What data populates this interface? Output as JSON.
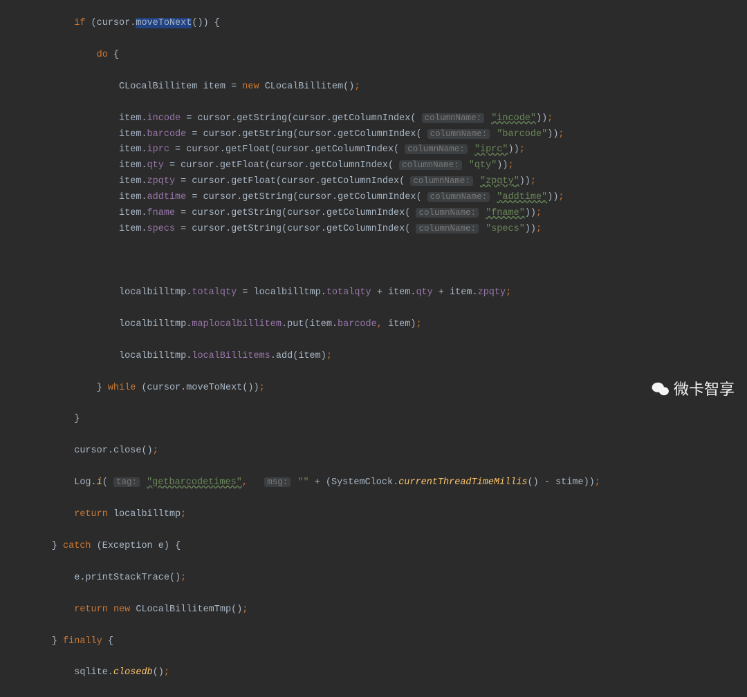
{
  "code": {
    "l1": {
      "kw_if": "if",
      "cur": "cursor",
      "mtn": "moveToNext"
    },
    "l2": {
      "kw_do": "do"
    },
    "l3": {
      "typ": "CLocalBillitem",
      "var": "item",
      "kw_new": "new",
      "ctor": "CLocalBillitem"
    },
    "item_assigns": [
      {
        "field": "incode",
        "getter": "getString",
        "col": "\"incode\"",
        "fieldClass": "fld",
        "strClass": "stru"
      },
      {
        "field": "barcode",
        "getter": "getString",
        "col": "\"barcode\"",
        "fieldClass": "fld",
        "strClass": "str"
      },
      {
        "field": "iprc",
        "getter": "getFloat",
        "col": "\"iprc\"",
        "fieldClass": "fld",
        "strClass": "stru"
      },
      {
        "field": "qty",
        "getter": "getFloat",
        "col": "\"qty\"",
        "fieldClass": "fld",
        "strClass": "str"
      },
      {
        "field": "zpqty",
        "getter": "getFloat",
        "col": "\"zpqty\"",
        "fieldClass": "fld",
        "strClass": "stru"
      },
      {
        "field": "addtime",
        "getter": "getString",
        "col": "\"addtime\"",
        "fieldClass": "fld",
        "strClass": "stru"
      },
      {
        "field": "fname",
        "getter": "getString",
        "col": "\"fname\"",
        "fieldClass": "fld",
        "strClass": "stru"
      },
      {
        "field": "specs",
        "getter": "getString",
        "col": "\"specs\"",
        "fieldClass": "fld",
        "strClass": "str"
      }
    ],
    "hint_columnName": "columnName:",
    "common": {
      "item": "item",
      "cursor": "cursor",
      "getColumnIndex": "getColumnIndex"
    },
    "lTotal": {
      "obj": "localbilltmp",
      "fld": "totalqty",
      "item": "item",
      "qty": "qty",
      "zp": "zpqty"
    },
    "lMap": {
      "obj": "localbilltmp",
      "fld": "maplocalbillitem",
      "put": "put",
      "arg1o": "item",
      "arg1f": "barcode",
      "arg2": "item"
    },
    "lList": {
      "obj": "localbilltmp",
      "fld": "localBillitems",
      "add": "add",
      "arg": "item"
    },
    "lWhile": {
      "kw": "while",
      "cur": "cursor",
      "mtn": "moveToNext"
    },
    "lClose": {
      "cur": "cursor",
      "close": "close"
    },
    "lLog": {
      "cls": "Log",
      "mth": "i",
      "hint_tag": "tag:",
      "tag": "\"getbarcodetimes\"",
      "hint_msg": "msg:",
      "empty": "\"\"",
      "sys": "SystemClock",
      "ctm": "currentThreadTimeMillis",
      "stime": "stime"
    },
    "lRet1": {
      "kw": "return",
      "var": "localbilltmp"
    },
    "lCatch": {
      "kw": "catch",
      "ex": "Exception",
      "var": "e"
    },
    "lPrint": {
      "var": "e",
      "mth": "printStackTrace"
    },
    "lRet2": {
      "kw": "return",
      "kw_new": "new",
      "ctor": "CLocalBillitemTmp"
    },
    "lFinally": {
      "kw": "finally"
    },
    "lSqlite": {
      "var": "sqlite",
      "mth": "closedb"
    }
  },
  "watermark": "微卡智享"
}
